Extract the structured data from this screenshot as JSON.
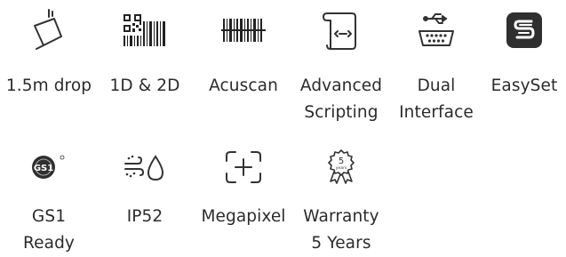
{
  "colors": {
    "text": "#2b2b2b",
    "icon_stroke": "#333333",
    "icon_dark": "#2f2f2f"
  },
  "features": [
    {
      "label": "1.5m drop",
      "icon": "drop-test-icon"
    },
    {
      "label": "1D & 2D",
      "icon": "barcode-qr-icon"
    },
    {
      "label": "Acuscan",
      "icon": "barcode-scan-icon"
    },
    {
      "label": "Advanced\nScripting",
      "icon": "script-scroll-icon"
    },
    {
      "label": "Dual\nInterface",
      "icon": "usb-serial-icon"
    },
    {
      "label": "EasySet",
      "icon": "easyset-logo-icon"
    },
    {
      "label": "GS1\nReady",
      "icon": "gs1-logo-icon",
      "icon_text": "GS1"
    },
    {
      "label": "IP52",
      "icon": "dust-water-icon"
    },
    {
      "label": "Megapixel",
      "icon": "megapixel-icon"
    },
    {
      "label": "Warranty\n5 Years",
      "icon": "warranty-badge-icon",
      "icon_text": "5",
      "icon_subtext": "years"
    }
  ]
}
